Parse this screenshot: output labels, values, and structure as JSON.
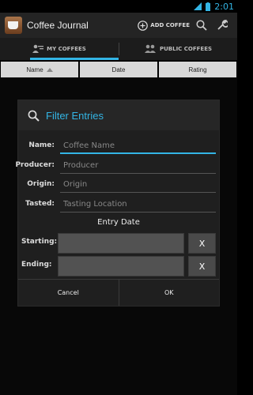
{
  "status_bar": {
    "time": "2:01"
  },
  "action_bar": {
    "title": "Coffee Journal",
    "add_label": "ADD COFFEE"
  },
  "tabs": [
    {
      "label": "MY COFFEES",
      "icon": "person-list-icon",
      "active": true
    },
    {
      "label": "PUBLIC COFFEES",
      "icon": "people-icon",
      "active": false
    }
  ],
  "columns": [
    {
      "label": "Name",
      "sorted": true
    },
    {
      "label": "Date"
    },
    {
      "label": "Rating"
    }
  ],
  "dialog": {
    "title": "Filter Entries",
    "fields": [
      {
        "label": "Name:",
        "placeholder": "Coffee Name",
        "focused": true
      },
      {
        "label": "Producer:",
        "placeholder": "Producer"
      },
      {
        "label": "Origin:",
        "placeholder": "Origin"
      },
      {
        "label": "Tasted:",
        "placeholder": "Tasting Location"
      }
    ],
    "entry_date_label": "Entry Date",
    "starting_label": "Starting:",
    "ending_label": "Ending:",
    "clear_label": "X",
    "cancel_label": "Cancel",
    "ok_label": "OK"
  },
  "colors": {
    "accent": "#33b5e5",
    "background": "#000000",
    "dialog_bg": "#1f1f1f"
  }
}
